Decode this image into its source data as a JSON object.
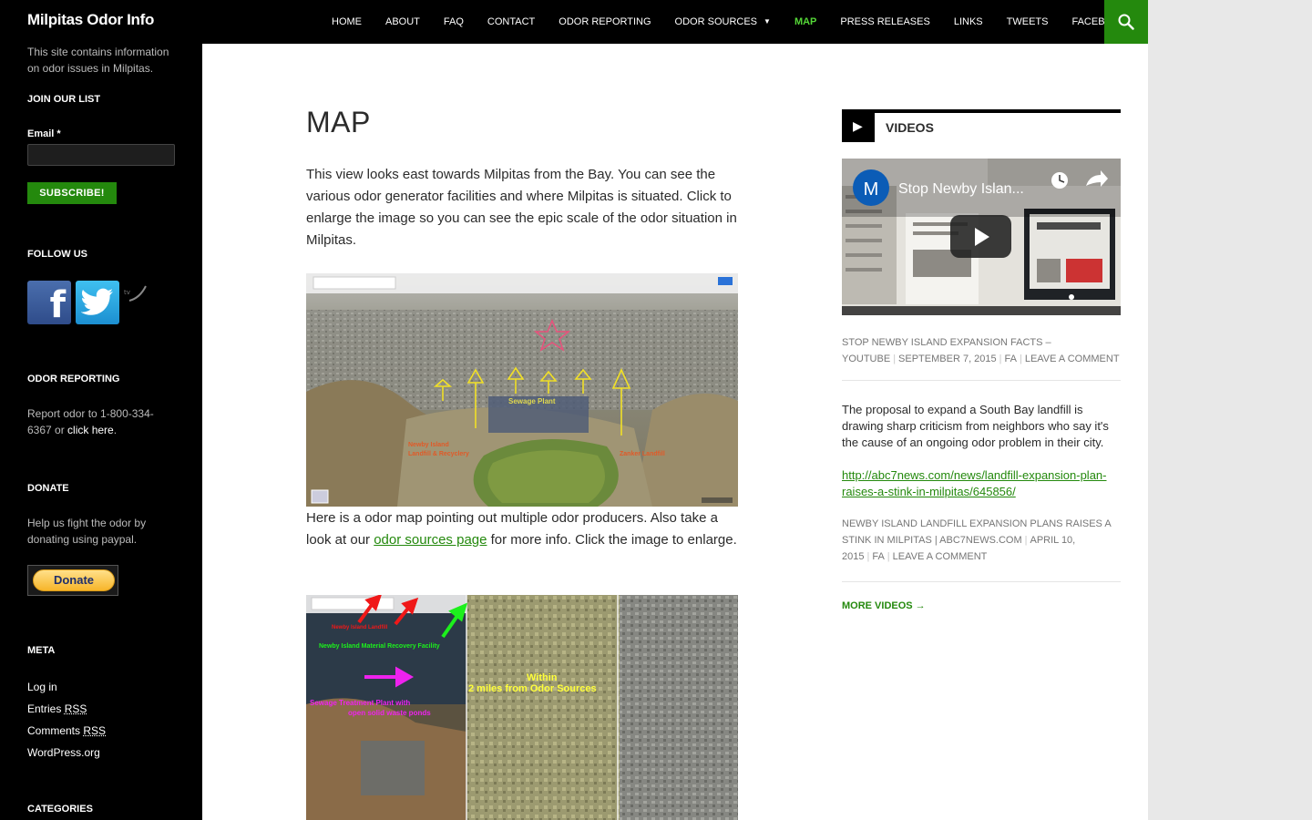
{
  "site": {
    "title": "Milpitas Odor Info",
    "description": "This site contains information on odor issues in Milpitas."
  },
  "nav": {
    "items": [
      {
        "label": "Home"
      },
      {
        "label": "About"
      },
      {
        "label": "FAQ"
      },
      {
        "label": "Contact"
      },
      {
        "label": "Odor Reporting"
      },
      {
        "label": "Odor Sources",
        "has_submenu": true
      },
      {
        "label": "Map",
        "current": true
      },
      {
        "label": "Press Releases"
      },
      {
        "label": "Links"
      },
      {
        "label": "Tweets"
      },
      {
        "label": "Facebook"
      }
    ],
    "search_icon": "search-icon",
    "accent_color": "#24890d",
    "current_color": "#55d737"
  },
  "sidebar": {
    "join": {
      "title": "Join Our List",
      "email_label": "Email *",
      "email_value": "",
      "subscribe_label": "Subscribe!"
    },
    "follow": {
      "title": "Follow Us",
      "facebook_glyph": "f",
      "icons": [
        "facebook-icon",
        "twitter-icon",
        "rss-icon"
      ]
    },
    "odor_reporting": {
      "title": "Odor Reporting",
      "text": "Report odor to 1-800-334-6367 or ",
      "link": "click here",
      "after": "."
    },
    "donate": {
      "title": "Donate",
      "text": "Help us fight the odor by donating using paypal.",
      "button_label": "Donate"
    },
    "meta": {
      "title": "Meta",
      "items": [
        "Log in",
        "Entries",
        "Comments",
        "WordPress.org"
      ],
      "rss_abbr": "RSS"
    },
    "categories": {
      "title": "Categories"
    }
  },
  "page": {
    "title": "Map",
    "para1": "This view looks east towards Milpitas from the Bay. You can see the various odor generator facilities and where Milpitas is situated. Click to enlarge the image so you can see the epic scale of the odor situation in Milpitas.",
    "image1_labels": {
      "sewage": "Sewage Plant",
      "newby": "Newby Island",
      "newby_sub": "Landfill & Recyclery",
      "zanker": "Zanker Landfill"
    },
    "para2_before": "Here is a odor map pointing out multiple odor producers.  Also take a look at our ",
    "para2_link": "odor sources page",
    "para2_after": " for more info. Click the image to enlarge.",
    "image2_labels": {
      "newby_landfill": "Newby Island Landfill",
      "mrf": "Newby Island Material Recovery Facility",
      "within": "Within",
      "two_miles": "2 miles from Odor Sources",
      "sewage": "Sewage Treatment Plant with",
      "sewage_sub": "open solid waste ponds"
    }
  },
  "videos": {
    "widget_title": "Videos",
    "video_title": "Stop Newby Islan...",
    "channel_initial": "M",
    "entry1": {
      "title": "Stop Newby Island Expansion Facts – YouTube",
      "date": "September 7, 2015",
      "author": "FA",
      "comment": "Leave a comment"
    },
    "entry2": {
      "text": "The proposal to expand a South Bay landfill is drawing sharp criticism from neighbors who say it's the cause of an ongoing odor problem in their city.",
      "link": "http://abc7news.com/news/landfill-expansion-plan-raises-a-stink-in-milpitas/645856/",
      "title": "Newby Island Landfill Expansion Plans Raises a Stink in Milpitas | abc7news.com",
      "date": "April 10, 2015",
      "author": "FA",
      "comment": "Leave a comment"
    },
    "more_label": "More Videos →"
  }
}
